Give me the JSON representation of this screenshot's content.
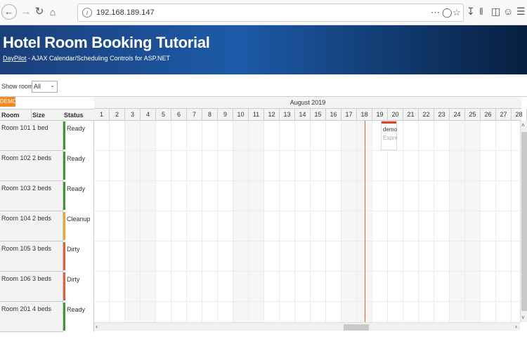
{
  "browser": {
    "url": "192.168.189.147",
    "icons": [
      "back-icon",
      "forward-icon",
      "reload-icon",
      "home-icon",
      "info-icon",
      "more-icon",
      "pocket-icon",
      "bookmark-star-icon",
      "download-icon",
      "library-icon",
      "sidebar-icon",
      "account-icon",
      "menu-icon"
    ]
  },
  "header": {
    "title": "Hotel Room Booking Tutorial",
    "link": "DayPilot",
    "subtitle": " - AJAX Calendar/Scheduling Controls for ASP.NET"
  },
  "filter": {
    "label": "Show rooms:",
    "value": "All"
  },
  "scheduler": {
    "demo_badge": "DEMO",
    "month": "August 2019",
    "columns": {
      "room": "Room",
      "size": "Size",
      "status": "Status"
    },
    "days": [
      "1",
      "2",
      "3",
      "4",
      "5",
      "6",
      "7",
      "8",
      "9",
      "10",
      "11",
      "12",
      "13",
      "14",
      "15",
      "16",
      "17",
      "18",
      "19",
      "20",
      "21",
      "22",
      "23",
      "24",
      "25",
      "26",
      "27",
      "28"
    ],
    "rooms": [
      {
        "name": "Room 101",
        "size": "1 bed",
        "status": "Ready",
        "color": "#3c9a2e"
      },
      {
        "name": "Room 102",
        "size": "2 beds",
        "status": "Ready",
        "color": "#3c9a2e"
      },
      {
        "name": "Room 103",
        "size": "2 beds",
        "status": "Ready",
        "color": "#3c9a2e"
      },
      {
        "name": "Room 104",
        "size": "2 beds",
        "status": "Cleanup",
        "color": "#f2a23a"
      },
      {
        "name": "Room 105",
        "size": "3 beds",
        "status": "Dirty",
        "color": "#e0603a"
      },
      {
        "name": "Room 106",
        "size": "3 beds",
        "status": "Dirty",
        "color": "#e0603a"
      },
      {
        "name": "Room 201",
        "size": "4 beds",
        "status": "Ready",
        "color": "#3c9a2e"
      }
    ],
    "event": {
      "text": "demo",
      "subtext": "Expre"
    },
    "colors": {
      "today_line": "#e0603a",
      "event_bar": "#d9452a",
      "demo_badge": "#f08a24"
    }
  }
}
